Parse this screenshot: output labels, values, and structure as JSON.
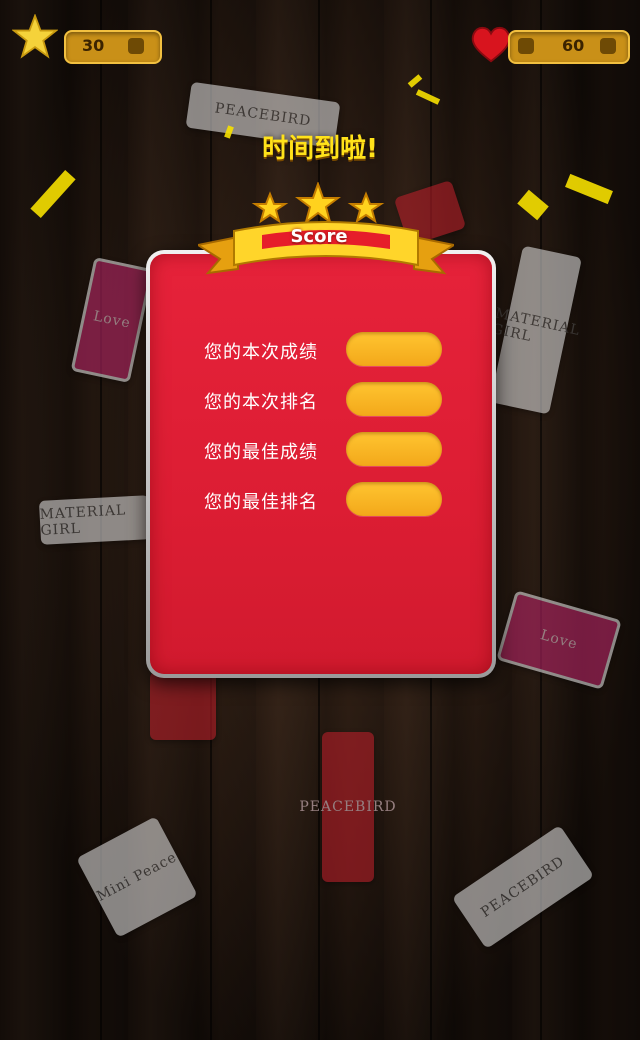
{
  "hud": {
    "stars_value": "30",
    "lives_value": "60"
  },
  "title": "时间到啦!",
  "card": {
    "badge_label": "Score",
    "rows": [
      {
        "label": "您的本次成绩",
        "value": ""
      },
      {
        "label": "您的本次排名",
        "value": ""
      },
      {
        "label": "您的最佳成绩",
        "value": ""
      },
      {
        "label": "您的最佳排名",
        "value": ""
      }
    ]
  },
  "colors": {
    "panel_red": "#e6223a",
    "field_yellow": "#ffc531",
    "title_yellow": "#ffe21a"
  },
  "background_tags": [
    {
      "kind": "white",
      "text": "PEACEBIRD"
    },
    {
      "kind": "pink",
      "text": "Love"
    },
    {
      "kind": "white",
      "text": "MATERIAL GIRL"
    },
    {
      "kind": "white",
      "text": "MATERIAL GIRL"
    },
    {
      "kind": "pink",
      "text": "Love"
    },
    {
      "kind": "red",
      "text": "PEACEBIRD"
    },
    {
      "kind": "white",
      "text": "Mini Peace"
    },
    {
      "kind": "white",
      "text": "PEACEBIRD"
    }
  ]
}
